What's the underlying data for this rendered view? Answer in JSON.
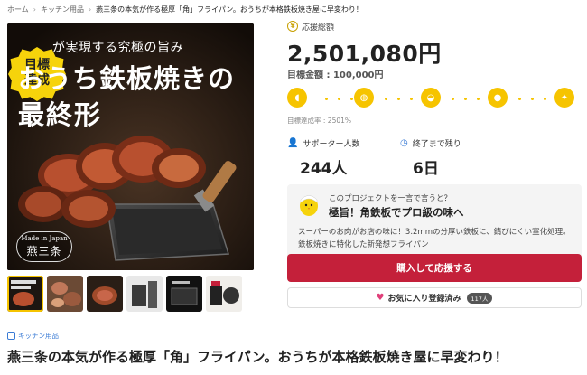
{
  "breadcrumb": {
    "items": [
      "ホーム",
      "キッチン用品"
    ],
    "current": "燕三条の本気が作る極厚「角」フライパン。おうちが本格鉄板焼き屋に早変わり！"
  },
  "hero": {
    "goal_badge": [
      "目標",
      "達成"
    ],
    "subtitle": "が実現する究極の旨み",
    "title_line1": "おうち鉄板焼きの",
    "title_line2": "最終形",
    "made_in_en": "Made in Japan",
    "made_in_jp": "燕三条"
  },
  "funding": {
    "total_label": "応援総額",
    "total_amount": "2,501,080円",
    "goal_label": "目標金額 : 100,000円",
    "rate_label": "目標達成率 : 2501%",
    "achievement_rate": 2501
  },
  "stats": {
    "supporters_label": "サポーター人数",
    "supporters_value": "244人",
    "remaining_label": "終了まで残り",
    "remaining_value": "6日"
  },
  "oneword": {
    "question": "このプロジェクトを一言で言うと？",
    "answer": "極旨！角鉄板でプロ級の味へ",
    "description": "スーパーのお肉がお店の味に！3.2mmの分厚い鉄板に、錆びにくい窒化処理。鉄板焼きに特化した新発想フライパン"
  },
  "actions": {
    "buy_label": "購入して応援する",
    "favorite_label": "お気に入り登録済み",
    "favorite_count": "117人"
  },
  "product": {
    "category": "キッチン用品",
    "title": "燕三条の本気が作る極厚「角」フライパン。おうちが本格鉄板焼き屋に早変わり！"
  },
  "colors": {
    "accent_yellow": "#f6c400",
    "buy_red": "#c4203a",
    "link_blue": "#3a7bd5"
  }
}
